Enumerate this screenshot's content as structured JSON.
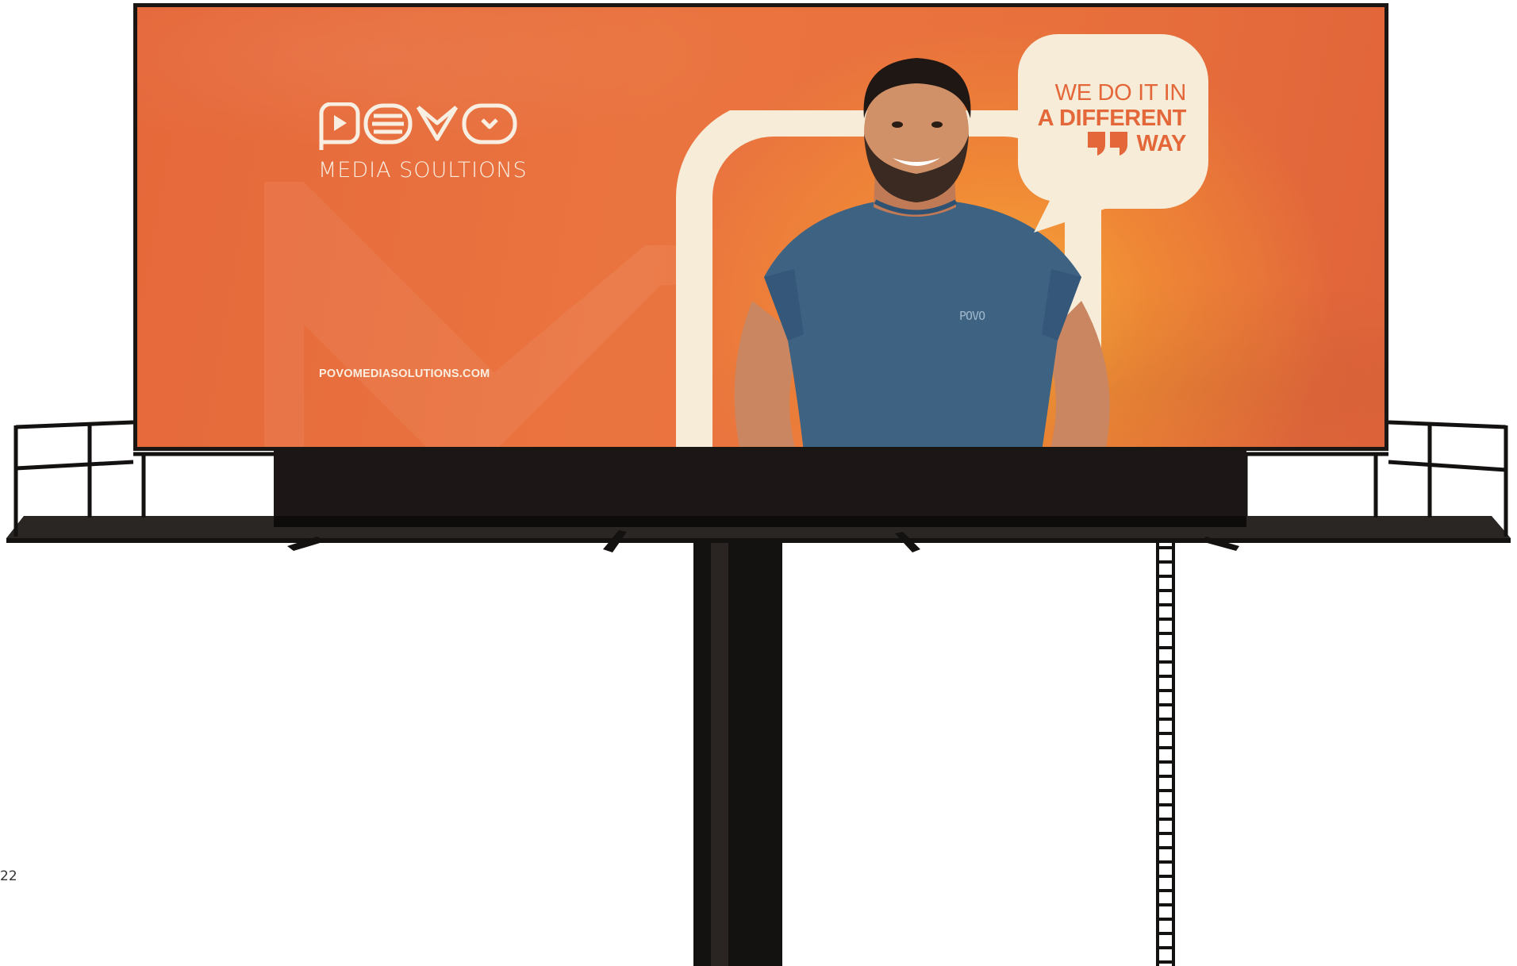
{
  "billboard": {
    "logo_wordmark": "POVO",
    "logo_tagline": "MEDIA SOULTIONS",
    "website": "POVOMEDIASOLUTIONS.COM",
    "bubble": {
      "line1": "WE DO IT IN",
      "line2": "A DIFFERENT",
      "line3": "WAY",
      "quote_icon": "quote-icon"
    },
    "shirt_logo": "POVO"
  },
  "page_number": "22",
  "colors": {
    "orange": "#e8703c",
    "cream": "#f7ecd8",
    "bubble_text": "#e4673a",
    "shirt": "#3c5f7f",
    "structure": "#141111"
  }
}
